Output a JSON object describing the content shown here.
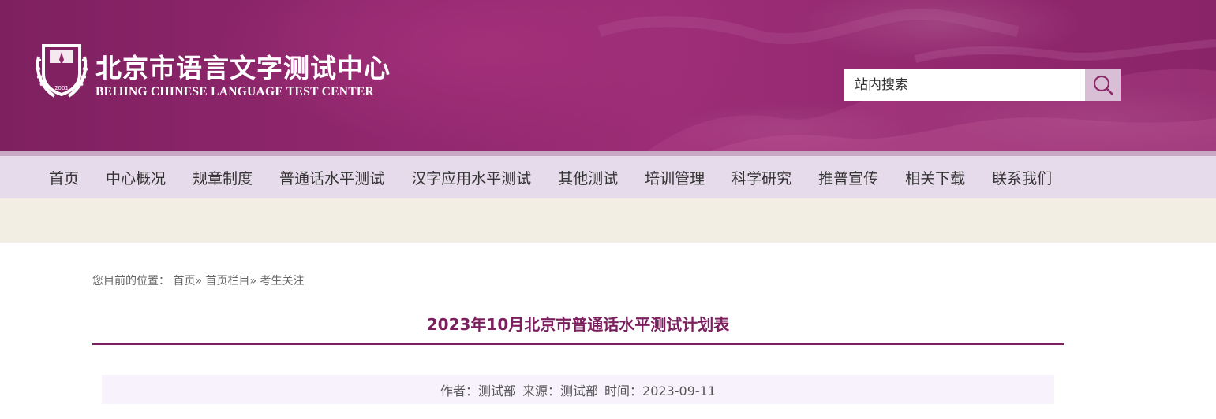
{
  "header": {
    "logo_cn": "北京市语言文字测试中心",
    "logo_en": "BEIJING CHINESE LANGUAGE TEST CENTER",
    "emblem_year": "2001",
    "search": {
      "placeholder": "站内搜索",
      "icon": "search-icon"
    }
  },
  "nav": {
    "items": [
      {
        "label": "首页"
      },
      {
        "label": "中心概况"
      },
      {
        "label": "规章制度"
      },
      {
        "label": "普通话水平测试"
      },
      {
        "label": "汉字应用水平测试"
      },
      {
        "label": "其他测试"
      },
      {
        "label": "培训管理"
      },
      {
        "label": "科学研究"
      },
      {
        "label": "推普宣传"
      },
      {
        "label": "相关下载"
      },
      {
        "label": "联系我们"
      }
    ]
  },
  "breadcrumb": {
    "prefix": "您目前的位置：",
    "items": [
      {
        "label": "首页"
      },
      {
        "label": "首页栏目"
      },
      {
        "label": "考生关注"
      }
    ],
    "separator": "»"
  },
  "article": {
    "title": "2023年10月北京市普通话水平测试计划表",
    "meta": {
      "author": "作者：测试部",
      "source": "来源：测试部",
      "time": "时间：2023-09-11"
    }
  },
  "colors": {
    "brand": "#8f2669",
    "title": "#7c1f5e",
    "nav_bg": "#e6dbeb",
    "band_bg": "#f2eee3",
    "meta_bg": "#f7f2fb"
  }
}
